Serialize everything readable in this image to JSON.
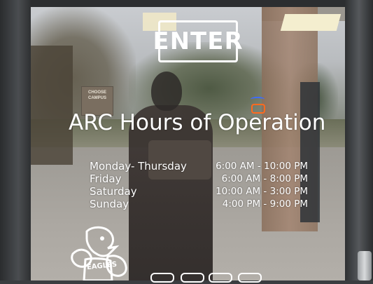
{
  "enter_sign": "ENTER",
  "title": "ARC Hours of Operation",
  "poster_text": "CHOOSE CAMPUS",
  "hours": [
    {
      "day": "Monday- Thursday",
      "time": "6:00 AM - 10:00 PM"
    },
    {
      "day": "Friday",
      "time": "6:00 AM - 8:00 PM"
    },
    {
      "day": "Saturday",
      "time": "10:00 AM - 3:00 PM"
    },
    {
      "day": "Sunday",
      "time": "4:00 PM - 9:00 PM"
    }
  ],
  "mascot_text": "EAGLES",
  "colors": {
    "decal": "#ffffff",
    "door_frame": "#3a3d40",
    "neon_blue": "#3d6cff",
    "neon_orange": "#ff6a1f"
  }
}
